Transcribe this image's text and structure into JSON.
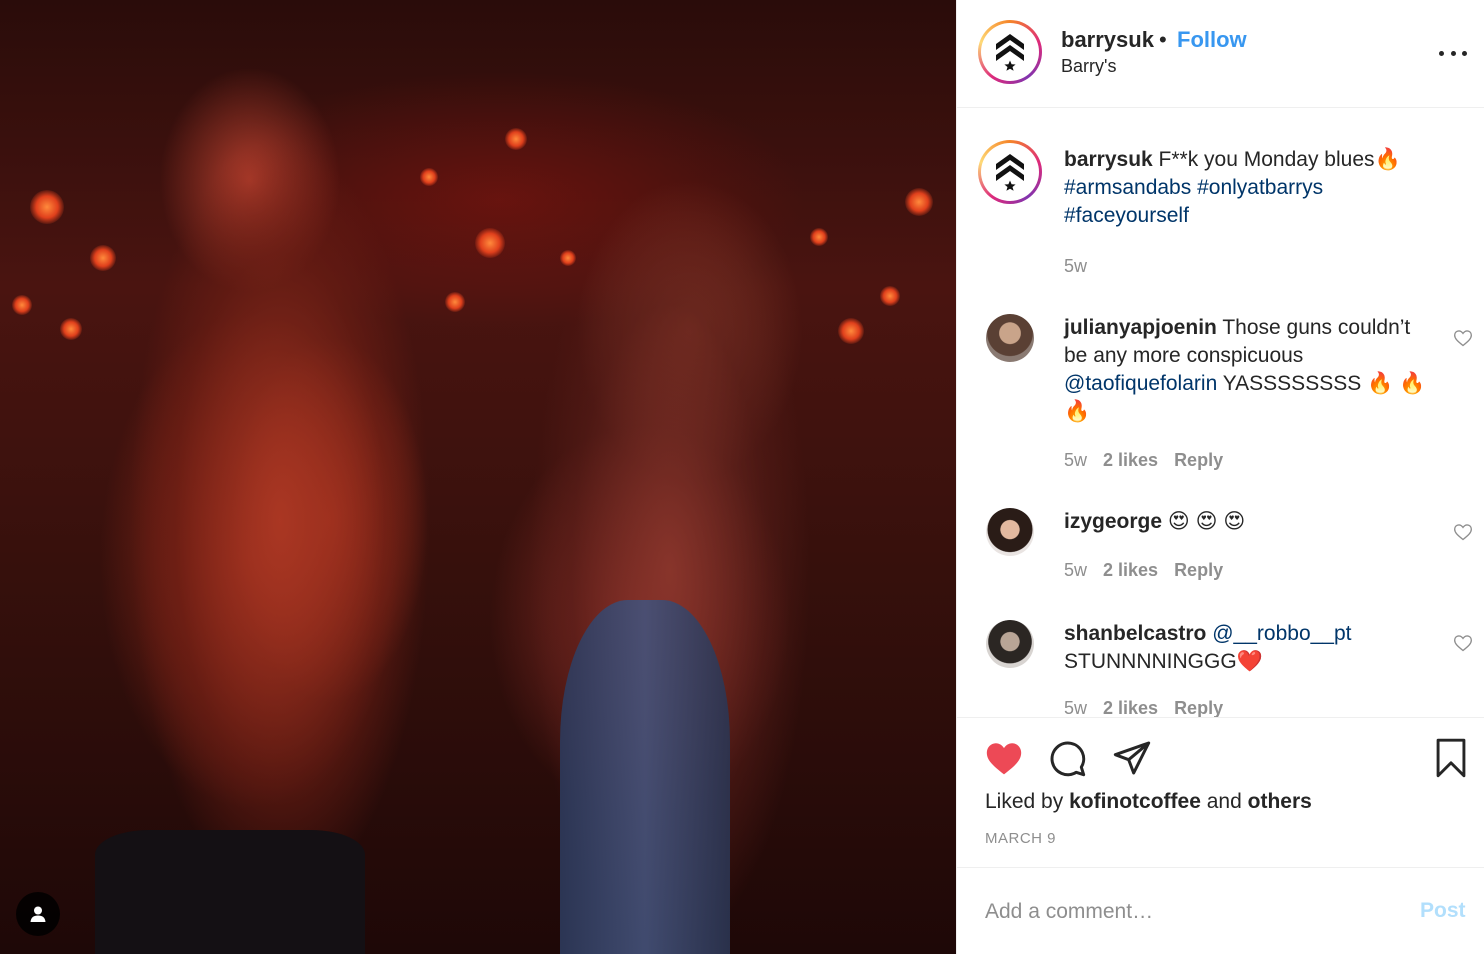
{
  "header": {
    "username": "barrysuk",
    "separator": "•",
    "follow_label": "Follow",
    "display_name": "Barry's"
  },
  "caption": {
    "username": "barrysuk",
    "text": " F**k you Monday blues🔥",
    "hashtags": [
      "#armsandabs",
      "#onlyatbarrys",
      "#faceyourself"
    ],
    "age": "5w"
  },
  "comments": [
    {
      "username": "julianyapjoenin",
      "text_before": " Those guns couldn’t be any more conspicuous ",
      "mention": "@taofiquefolarin",
      "text_after": " YASSSSSSSS 🔥 🔥 🔥",
      "age": "5w",
      "likes": "2 likes",
      "reply": "Reply"
    },
    {
      "username": "izygeorge",
      "text_before": " 😍 😍 😍",
      "mention": "",
      "text_after": "",
      "age": "5w",
      "likes": "2 likes",
      "reply": "Reply"
    },
    {
      "username": "shanbelcastro",
      "text_before": " ",
      "mention": "@__robbo__pt",
      "text_after": " STUNNNNINGGG❤️",
      "age": "5w",
      "likes": "2 likes",
      "reply": "Reply"
    }
  ],
  "actions": {
    "liked_by_prefix": "Liked by ",
    "liked_by_user": "kofinotcoffee",
    "liked_by_and": " and ",
    "liked_by_others": "others",
    "date": "MARCH 9"
  },
  "add_comment": {
    "placeholder": "Add a comment…",
    "post_label": "Post"
  },
  "colors": {
    "link": "#003569",
    "follow": "#3897f0",
    "like_red": "#ed4956",
    "muted": "#8e8e8e",
    "post_disabled": "#b2dffc"
  },
  "icons": [
    "user-tag-icon",
    "more-options-icon",
    "heart-icon",
    "comment-icon",
    "share-icon",
    "bookmark-icon"
  ]
}
